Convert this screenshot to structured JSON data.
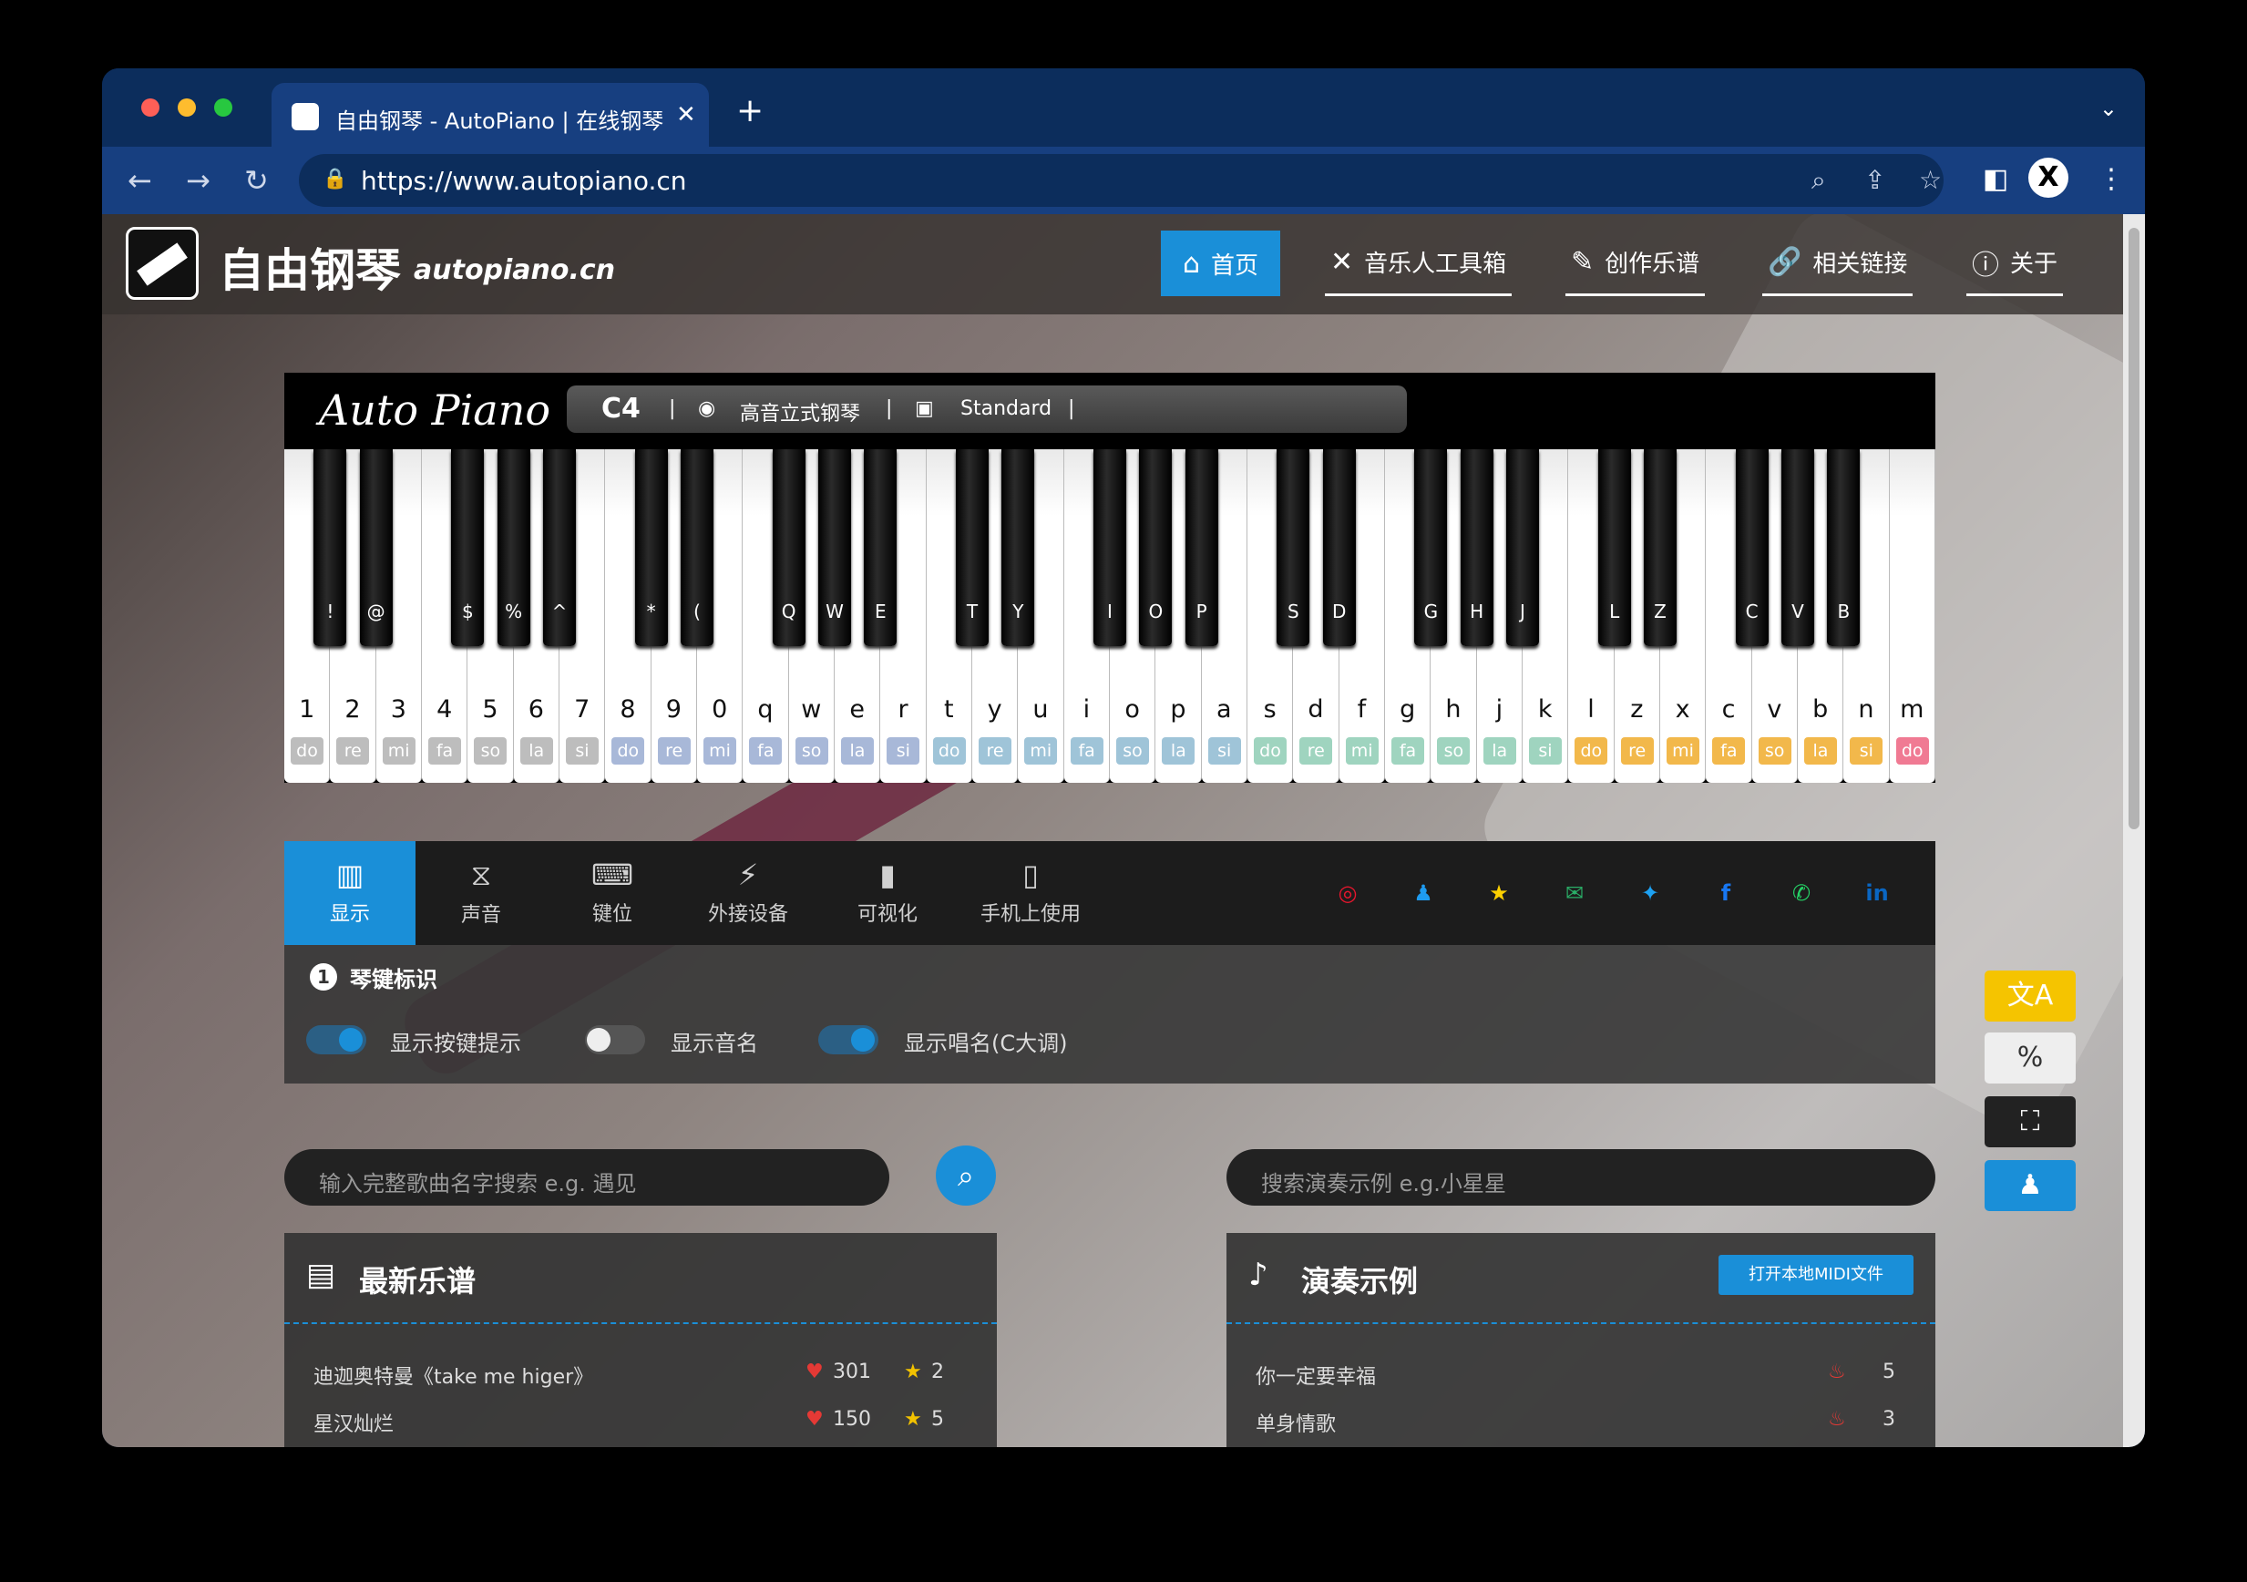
{
  "browser": {
    "tab_title": "自由钢琴 - AutoPiano | 在线钢琴",
    "tab_close": "✕",
    "new_tab": "+",
    "url": "https://www.autopiano.cn"
  },
  "header": {
    "brand": "自由钢琴",
    "domain": "autopiano.cn",
    "menu": [
      {
        "label": "首页",
        "icon": "home-icon"
      },
      {
        "label": "音乐人工具箱",
        "icon": "tools-icon"
      },
      {
        "label": "创作乐谱",
        "icon": "pen-icon"
      },
      {
        "label": "相关链接",
        "icon": "link-icon"
      },
      {
        "label": "关于",
        "icon": "info-icon"
      }
    ]
  },
  "piano": {
    "script_title": "Auto Piano",
    "octave": "C4",
    "sep": "|",
    "instrument": "高音立式钢琴",
    "mode": "Standard",
    "white_keys": [
      "1",
      "2",
      "3",
      "4",
      "5",
      "6",
      "7",
      "8",
      "9",
      "0",
      "q",
      "w",
      "e",
      "r",
      "t",
      "y",
      "u",
      "i",
      "o",
      "p",
      "a",
      "s",
      "d",
      "f",
      "g",
      "h",
      "j",
      "k",
      "l",
      "z",
      "x",
      "c",
      "v",
      "b",
      "n",
      "m"
    ],
    "solfege": [
      "do",
      "re",
      "mi",
      "fa",
      "so",
      "la",
      "si",
      "do",
      "re",
      "mi",
      "fa",
      "so",
      "la",
      "si",
      "do",
      "re",
      "mi",
      "fa",
      "so",
      "la",
      "si",
      "do",
      "re",
      "mi",
      "fa",
      "so",
      "la",
      "si",
      "do",
      "re",
      "mi",
      "fa",
      "so",
      "la",
      "si",
      "do"
    ],
    "solfege_colors": [
      "#bdbdbd",
      "#a8b8d8",
      "#9fc4d8",
      "#9fd4bf",
      "#f2b84b",
      "#f39b54",
      "#f07a93"
    ],
    "black_keys": [
      "!",
      "@",
      "$",
      "%",
      "^",
      "*",
      "(",
      "Q",
      "W",
      "E",
      "T",
      "Y",
      "I",
      "O",
      "P",
      "S",
      "D",
      "G",
      "H",
      "J",
      "L",
      "Z",
      "C",
      "V",
      "B"
    ]
  },
  "control_tabs": [
    {
      "label": "显示",
      "icon": "piano-icon"
    },
    {
      "label": "声音",
      "icon": "waveform-icon"
    },
    {
      "label": "键位",
      "icon": "keyboard-icon"
    },
    {
      "label": "外接设备",
      "icon": "plug-icon"
    },
    {
      "label": "可视化",
      "icon": "bar-chart-icon"
    },
    {
      "label": "手机上使用",
      "icon": "phone-icon"
    }
  ],
  "social": [
    {
      "name": "weibo-icon",
      "color": "#e6162d"
    },
    {
      "name": "qq-icon",
      "color": "#1e9bf0"
    },
    {
      "name": "qzone-icon",
      "color": "#fcd000"
    },
    {
      "name": "wechat-icon",
      "color": "#2aae67"
    },
    {
      "name": "twitter-icon",
      "color": "#1da1f2"
    },
    {
      "name": "facebook-icon",
      "color": "#1877f2"
    },
    {
      "name": "whatsapp-icon",
      "color": "#25d366"
    },
    {
      "name": "linkedin-icon",
      "color": "#0a66c2"
    }
  ],
  "key_panel": {
    "number": "1",
    "title": "琴键标识",
    "toggles": [
      {
        "label": "显示按键提示",
        "on": true
      },
      {
        "label": "显示音名",
        "on": false
      },
      {
        "label": "显示唱名(C大调)",
        "on": true
      }
    ]
  },
  "search": {
    "song_placeholder": "输入完整歌曲名字搜索   e.g. 遇见",
    "demo_placeholder": "搜索演奏示例   e.g.小星星"
  },
  "latest": {
    "title": "最新乐谱",
    "rows": [
      {
        "name": "迪迦奥特曼《take me higer》",
        "likes": "301",
        "stars": "2"
      },
      {
        "name": "星汉灿烂",
        "likes": "150",
        "stars": "5"
      }
    ]
  },
  "demos": {
    "title": "演奏示例",
    "midi_button": "打开本地MIDI文件",
    "rows": [
      {
        "name": "你一定要幸福",
        "hot": "5"
      },
      {
        "name": "单身情歌",
        "hot": "3"
      }
    ]
  },
  "side_buttons": [
    {
      "name": "translate-icon",
      "glyph": "文A"
    },
    {
      "name": "no-effects-icon",
      "glyph": "%"
    },
    {
      "name": "screenshot-icon",
      "glyph": "⛶"
    },
    {
      "name": "qq-group-icon",
      "glyph": "♟"
    }
  ]
}
